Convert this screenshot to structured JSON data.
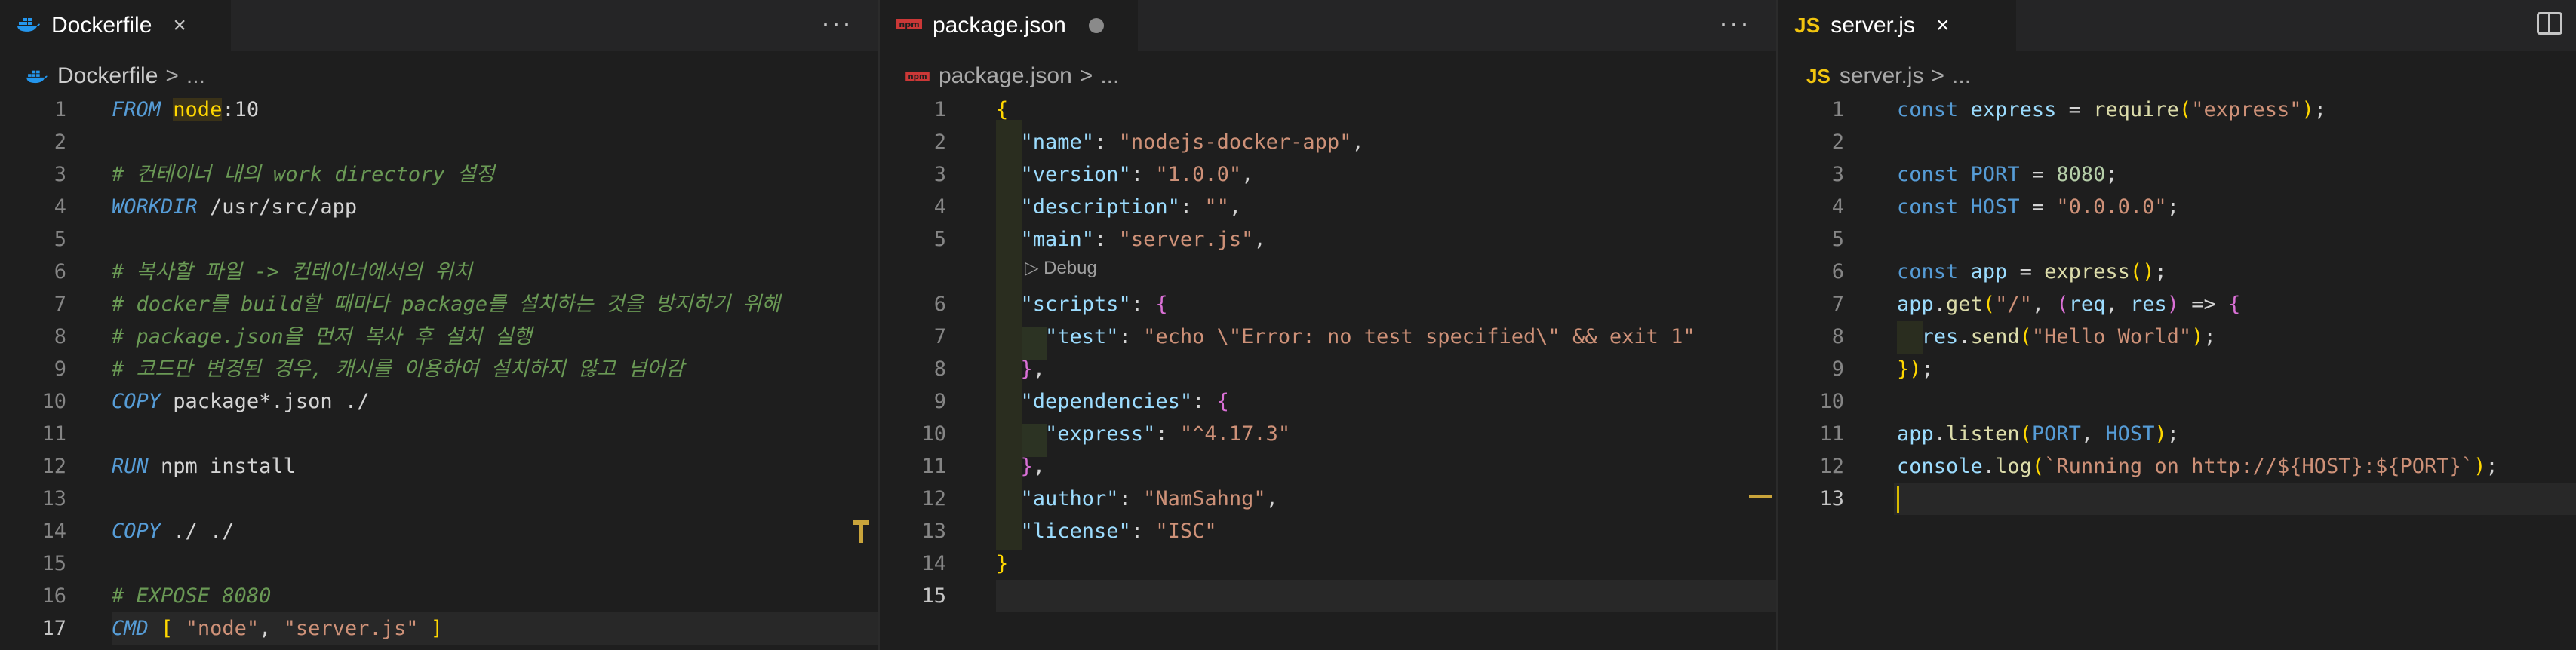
{
  "panes": [
    {
      "tab": {
        "label": "Dockerfile",
        "icon": "docker-icon",
        "close": "×"
      },
      "more": "···",
      "breadcrumb": {
        "file": "Dockerfile",
        "sep": ">",
        "rest": "..."
      },
      "lines": [
        "FROM node:10",
        "",
        "# 컨테이너 내의 work directory 설정",
        "WORKDIR /usr/src/app",
        "",
        "# 복사할 파일 -> 컨테이너에서의 위치",
        "# docker를 build할 때마다 package를 설치하는 것을 방지하기 위해",
        "# package.json을 먼저 복사 후 설치 실행",
        "# 코드만 변경된 경우, 캐시를 이용하여 설치하지 않고 넘어감",
        "COPY package*.json ./",
        "",
        "RUN npm install",
        "",
        "COPY ./ ./",
        "",
        "# EXPOSE 8080",
        "CMD [ \"node\", \"server.js\" ]"
      ],
      "current_line": 17
    },
    {
      "tab": {
        "label": "package.json",
        "icon": "npm-icon"
      },
      "more": "···",
      "breadcrumb": {
        "file": "package.json",
        "sep": ">",
        "rest": "..."
      },
      "lines": [
        "{",
        "  \"name\": \"nodejs-docker-app\",",
        "  \"version\": \"1.0.0\",",
        "  \"description\": \"\",",
        "  \"main\": \"server.js\",",
        "  \"scripts\": {",
        "    \"test\": \"echo \\\"Error: no test specified\\\" && exit 1\"",
        "  },",
        "  \"dependencies\": {",
        "    \"express\": \"^4.17.3\"",
        "  },",
        "  \"author\": \"NamSahng\",",
        "  \"license\": \"ISC\"",
        "}",
        ""
      ],
      "codelens": "▷ Debug",
      "current_line": 15
    },
    {
      "tab": {
        "label": "server.js",
        "icon": "js-icon",
        "icon_text": "JS",
        "close": "×"
      },
      "breadcrumb": {
        "file": "server.js",
        "sep": ">",
        "rest": "..."
      },
      "lines": [
        "const express = require(\"express\");",
        "",
        "const PORT = 8080;",
        "const HOST = \"0.0.0.0\";",
        "",
        "const app = express();",
        "app.get(\"/\", (req, res) => {",
        "  res.send(\"Hello World\");",
        "});",
        "",
        "app.listen(PORT, HOST);",
        "console.log(`Running on http://${HOST}:${PORT}`);",
        ""
      ],
      "current_line": 13
    }
  ],
  "colors": {
    "background": "#1e1e1e",
    "tabbar": "#252526",
    "comment": "#6a9955",
    "keyword": "#569cd6",
    "string": "#ce9178",
    "number": "#b5cea8"
  }
}
